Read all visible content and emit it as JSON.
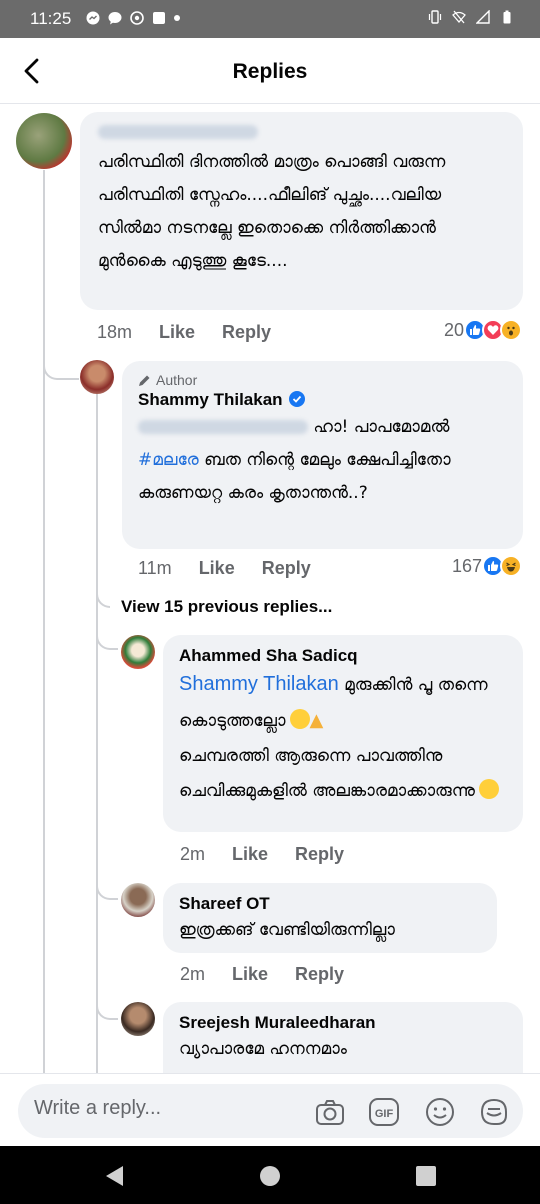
{
  "status_bar": {
    "time": "11:25"
  },
  "header": {
    "title": "Replies"
  },
  "comments": [
    {
      "text": "പരിസ്ഥിതി ദിനത്തിൽ മാത്രം പൊങ്ങി വരുന്ന പരിസ്ഥിതി സ്നേഹം....ഫീലിങ് പുച്ഛം....വലിയ സിൽമാ നടനല്ലേ ഇതൊക്കെ നിർത്തിക്കാൻ മുൻകൈ എടുത്തു കൂടേ....",
      "time": "18m",
      "like": "Like",
      "reply": "Reply",
      "reactions": "20"
    },
    {
      "author_tag": "Author",
      "name": "Shammy Thilakan",
      "text_after_mention": "ഹാ! പാപമോമൽ",
      "hashtag": "#മലരേ",
      "text": "ബത നിന്റെ മേലും ക്ഷേപിച്ചിതോ കരുണയറ്റ കരം കൃതാന്തൻ..?",
      "time": "11m",
      "like": "Like",
      "reply": "Reply",
      "reactions": "167"
    },
    {
      "name": "Ahammed Sha Sadicq",
      "mention": "Shammy Thilakan",
      "text_a": "മുരുക്കിൻ പൂ തന്നെ കൊടുത്തല്ലോ",
      "text_b": "ചെമ്പരത്തി ആരുന്നെ പാവത്തിനു ചെവിക്കുമുകളിൽ അലങ്കാരമാക്കാരുന്നു",
      "time": "2m",
      "like": "Like",
      "reply": "Reply"
    },
    {
      "name": "Shareef OT",
      "text": "ഇത്രക്കങ് വേണ്ടിയിരുന്നില്ലാ",
      "time": "2m",
      "like": "Like",
      "reply": "Reply"
    },
    {
      "name": "Sreejesh Muraleedharan",
      "text": "വ്യാപാരമേ ഹനനമാം"
    }
  ],
  "view_previous": "View 15 previous replies...",
  "composer": {
    "placeholder": "Write a reply..."
  },
  "icons": {
    "back": "chevron-left-icon",
    "camera": "camera-icon",
    "gif": "gif-icon",
    "emoji": "smiley-icon",
    "sticker": "sticker-icon"
  },
  "colors": {
    "accent": "#1877f2",
    "bubble": "#f0f2f5",
    "mention": "#216fdb"
  }
}
